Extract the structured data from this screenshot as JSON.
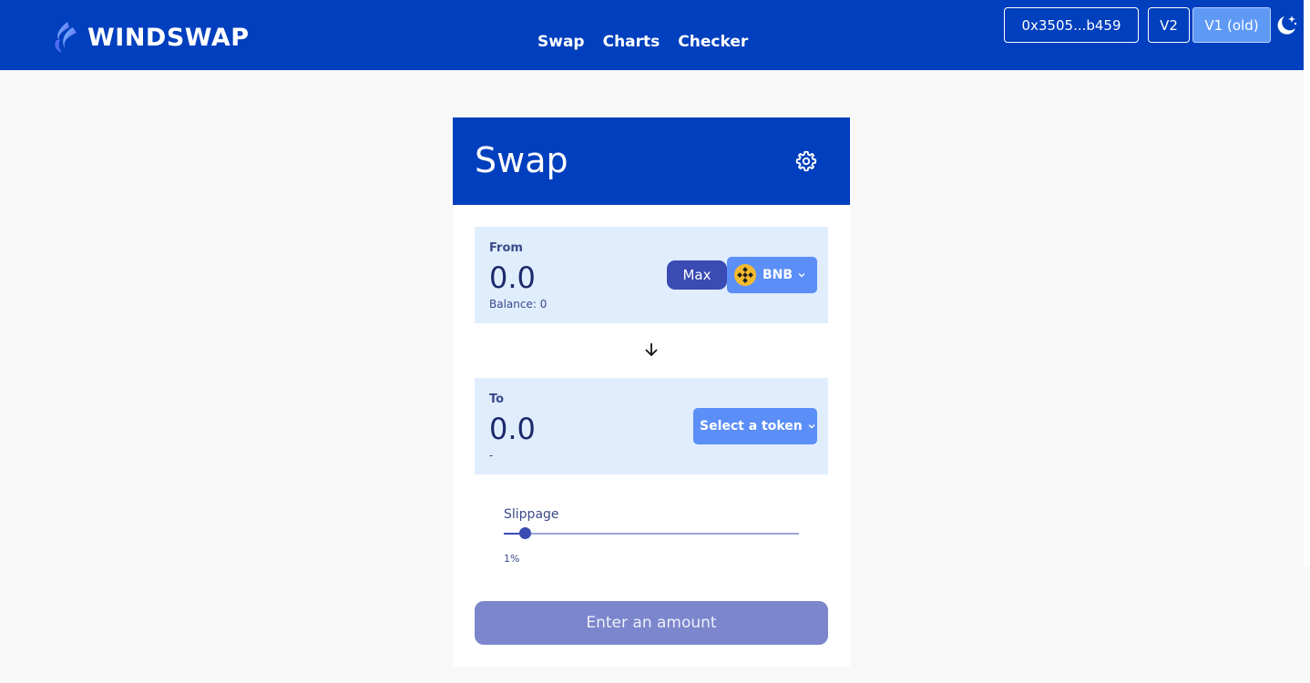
{
  "header": {
    "brand": "WINDSWAP",
    "nav": [
      {
        "label": "Swap"
      },
      {
        "label": "Charts"
      },
      {
        "label": "Checker"
      }
    ],
    "wallet_label": "0x3505...b459",
    "v2_label": "V2",
    "v1_label": "V1 (old)",
    "theme_icon": "moon-stars-icon",
    "colors": {
      "bar": "#003fbd",
      "active_version": "#5f99f6"
    }
  },
  "swap": {
    "title": "Swap",
    "settings_icon": "gear-icon",
    "from": {
      "label": "From",
      "amount": "0.0",
      "balance": "Balance: 0",
      "max_label": "Max",
      "token": "BNB",
      "token_icon": "bnb-icon"
    },
    "switch_icon": "arrow-down-icon",
    "to": {
      "label": "To",
      "amount": "0.0",
      "balance": "-",
      "token_select": "Select a token"
    },
    "slippage": {
      "label": "Slippage",
      "value_text": "1%",
      "value": 0.07
    },
    "submit_label": "Enter an amount"
  }
}
